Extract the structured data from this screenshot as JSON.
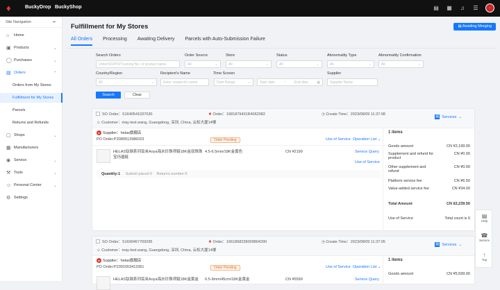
{
  "topbar": {
    "brand1": "BuckyDrop",
    "brand2": "BuckyShop",
    "avatar": "·"
  },
  "sidebar": {
    "header": "Site Navigation",
    "items": [
      {
        "label": "Home"
      },
      {
        "label": "Products"
      },
      {
        "label": "Purchases"
      },
      {
        "label": "Orders"
      },
      {
        "label": "Orders from My Stores"
      },
      {
        "label": "Fulfillment for My Stores"
      },
      {
        "label": "Parcels"
      },
      {
        "label": "Returns and Refunds"
      },
      {
        "label": "Shops"
      },
      {
        "label": "Manufacturers"
      },
      {
        "label": "Service"
      },
      {
        "label": "Tools"
      },
      {
        "label": "Personal Center"
      },
      {
        "label": "Settings"
      }
    ]
  },
  "page": {
    "title": "Fulfillment for My Stores",
    "awaiting_merging": "Awaiting Merging"
  },
  "tabs": [
    "All Orders",
    "Processing",
    "Awaiting Delivery",
    "Parcels with Auto-Submission Failure"
  ],
  "filters": {
    "search_orders": "Search Orders",
    "search_placeholder": "Order/SO/PO/Tracking No. or product name",
    "order_source": "Order Source",
    "store": "Store",
    "status": "Status",
    "abnormality_type": "Abnormality Type",
    "abnormality_confirmation": "Abnormality Confirmation",
    "all": "All",
    "country_region": "Country/Region",
    "recipients_name": "Recipient's Name",
    "recipients_placeholder": "Enter recipient's name",
    "time_screen": "Time Screen",
    "date_range": "Date Range",
    "start_date": "Start date",
    "end_date": "End date",
    "to": "~",
    "supplier": "Supplier",
    "supplier_placeholder": "Supplier Name",
    "search_btn": "Search",
    "clear_btn": "Clear"
  },
  "orders": [
    {
      "so": "SO Order：S1640541037030",
      "order": "Order：1681879431R4062082",
      "create_time": "Create Time：2023/08/09 11:37:08",
      "customer": "Customer：may-test.wang, Guangdong, 深圳, China, 云松大厦14楼",
      "services": "Services",
      "supplier": "Supplier：helas旗舰店",
      "po": "PO Order:P2080512986023",
      "status": "Order Pending",
      "use_of_service": "Use of Service",
      "operation_list": "Operation List",
      "product_name": "HELAS钛钢系列耳夹Aoya海水珍珠项链18K金双珠珠宝玛瑙链",
      "spec": "4.5-6.5mm/18K金黄色",
      "price": "CN ¥2199",
      "service_query": "Service Query",
      "use_of_service2": "Use of Service",
      "quantity": "Quantity:1",
      "submit_parcel": "Submit parcel:0",
      "returns_number": "Returns number:0",
      "items": "1 items",
      "goods_amount": "Goods amount",
      "goods_amount_v": "CN ¥2,199.00",
      "supplement": "Supplement and refund for product",
      "supplement_v": "CN ¥0.00",
      "other_supplement": "Other supplement and refund",
      "other_supplement_v": "CN ¥0.00",
      "platform_fee": "Platform service fee",
      "platform_fee_v": "CN ¥6.50",
      "value_added": "Value-added service fee",
      "value_added_v": "CN ¥34.00",
      "total": "Total Amount",
      "total_v": "CN ¥2,239.50",
      "use_of_service3": "Use of Service",
      "total_count": "Total count is 6"
    },
    {
      "so": "SO Order：S1690457769295",
      "order": "Order：1661868239009804290",
      "create_time": "Create Time：2023/08/09 11:37:05",
      "customer": "Customer：may-test.wang, Guangdong, 深圳, China, 云松大厦14楼",
      "services": "Services",
      "supplier": "Supplier：helas旗舰店",
      "po": "PO Order:P2391653413361",
      "status": "Order Pending",
      "use_of_service": "Use of Service",
      "operation_list": "Operation List",
      "product_name": "HELAS钛钢系列耳夹Aoya海水珍珠项链18K金黄金",
      "spec": "6.5-9mm/45cm/18K金黄金",
      "price": "CN ¥5599",
      "service_query": "Service Query",
      "items": "1 items",
      "goods_amount": "Goods amount",
      "goods_amount_v": "CN ¥5,599.00"
    }
  ],
  "floatbar": {
    "help": "Help",
    "service": "Service",
    "top": "Top"
  }
}
